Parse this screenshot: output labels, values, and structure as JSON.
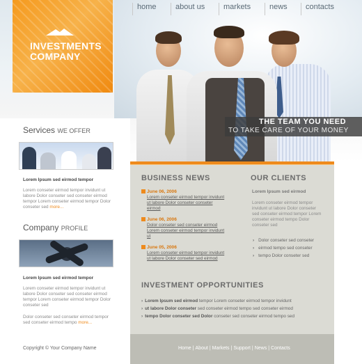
{
  "nav": {
    "items": [
      {
        "label": "home"
      },
      {
        "label": "about us"
      },
      {
        "label": "markets"
      },
      {
        "label": "news"
      },
      {
        "label": "contacts"
      }
    ]
  },
  "logo": {
    "line1": "INVESTMENTS",
    "line2": "COMPANY"
  },
  "slogan": {
    "line1": "THE TEAM YOU NEED",
    "line2": "TO TAKE CARE OF YOUR MONEY"
  },
  "services": {
    "title": "Services",
    "title_sub": "WE OFFER",
    "heading": "Lorem Ipsum sed eirmod tempor",
    "text": "Lorem conseter eirmod tempor invidunt ut labore Dolor conseter sed conseter eirmod tempor Lorem conseter eirmod tempor Dolor conseter sed",
    "more": "more..."
  },
  "profile": {
    "title": "Company",
    "title_sub": "PROFILE",
    "heading": "Lorem Ipsum sed eirmod tempor",
    "text1": "Lorem conseter eirmod tempor invidunt ut labore Dolor conseter sed conseter eirmod tempor Lorem conseter eirmod tempor Dolor conseter sed",
    "text2": "Dolor conseter sed conseter eirmod tempor sed conseter eirmod tempo",
    "more": "more..."
  },
  "business_news": {
    "title": "BUSINESS NEWS",
    "items": [
      {
        "date": "June 06, 2006",
        "text": "Lorem conseter eirmod tempor invidunt ut labore Dolor conseter conseter eirmod"
      },
      {
        "date": "June 06, 2006",
        "text": "Dolor conseter sed conseter eirmod Lorem conseter eirmod tempor invidunt ut"
      },
      {
        "date": "June 05, 2006",
        "text": "Lorem conseter eirmod tempor invidunt ut labore Dolor conseter sed eirmod"
      }
    ]
  },
  "clients": {
    "title": "OUR CLIENTS",
    "heading": "Lorem Ipsum sed eirmod",
    "text": "Lorem conseter eirmod tempor invidunt ut labore Dolor conseter sed conseter eirmod tempor Lorem conseter eirmod tempo Dolor conseter sed",
    "items": [
      "Dolor conseter sed conseter",
      "eirmod tempo sed conseter",
      "tempo Dolor conseter sed"
    ]
  },
  "investment": {
    "title": "INVESTMENT OPPORTUNITIES",
    "items": [
      {
        "bold": "Lorem Ipsum sed eirmod",
        "rest": "tempor Lorem conseter eirmod tempor invidunt"
      },
      {
        "bold": "ut labore Dolor conseter",
        "rest": "sed conseter eirmod tempo sed conseter eirmod"
      },
      {
        "bold": "tempo Dolor conseter sed Dolor",
        "rest": "conseter sed conseter eirmod tempo sed"
      }
    ]
  },
  "footer": {
    "copyright": "Copyright © Your Company Name",
    "links": [
      "Home",
      "About",
      "Markets",
      "Support",
      "News",
      "Contacts"
    ]
  },
  "colors": {
    "accent": "#ee8a1c",
    "panel": "#dbdbd4",
    "footer_bar": "#bdbdb5"
  }
}
